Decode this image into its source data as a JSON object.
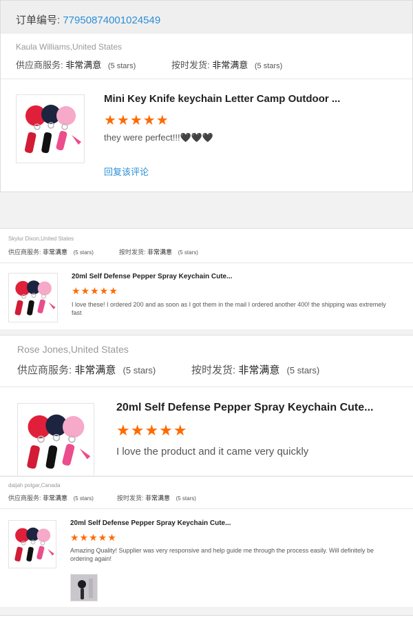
{
  "reviews": [
    {
      "order_label": "订单编号:",
      "order_number": "77950874001024549",
      "reviewer": "Kaula Williams,United States",
      "supplier_label": "供应商服务:",
      "supplier_value": "非常满意",
      "supplier_rating": "(5 stars)",
      "shipping_label": "按时发货:",
      "shipping_value": "非常满意",
      "shipping_rating": "(5 stars)",
      "product_title": "Mini Key Knife keychain Letter Camp Outdoor ...",
      "stars": "★★★★★",
      "review_text": "they were perfect!!!🖤🖤🖤",
      "reply_link": "回复该评论"
    },
    {
      "reviewer": "Skylur Dixon,United States",
      "supplier_label": "供应商服务:",
      "supplier_value": "非常满意",
      "supplier_rating": "(5 stars)",
      "shipping_label": "按时发货:",
      "shipping_value": "非常满意",
      "shipping_rating": "(5 stars)",
      "product_title": "20ml Self Defense Pepper Spray Keychain Cute...",
      "stars": "★★★★★",
      "review_text": "I love these! I ordered 200 and as soon as I got them in the mail I ordered another 400! the shipping was extremely fast"
    },
    {
      "reviewer": "Rose Jones,United States",
      "supplier_label": "供应商服务:",
      "supplier_value": "非常满意",
      "supplier_rating": "(5 stars)",
      "shipping_label": "按时发货:",
      "shipping_value": "非常满意",
      "shipping_rating": "(5 stars)",
      "product_title": "20ml Self Defense Pepper Spray Keychain Cute...",
      "stars": "★★★★★",
      "review_text": "I love the product and it came very quickly"
    },
    {
      "reviewer": "daijah polgar,Canada",
      "supplier_label": "供应商服务:",
      "supplier_value": "非常满意",
      "supplier_rating": "(5 stars)",
      "shipping_label": "按时发货:",
      "shipping_value": "非常满意",
      "shipping_rating": "(5 stars)",
      "product_title": "20ml Self Defense Pepper Spray Keychain Cute...",
      "stars": "★★★★★",
      "review_text": "Amazing Quality! Supplier was very responsive and help guide me through the process easily. Will definitely be ordering again!"
    }
  ],
  "colors": {
    "link": "#2b8fd6",
    "star": "#ff6a00",
    "pom_red": "#e0203a",
    "pom_navy": "#1c2440",
    "pom_pink": "#f6a9c8"
  }
}
